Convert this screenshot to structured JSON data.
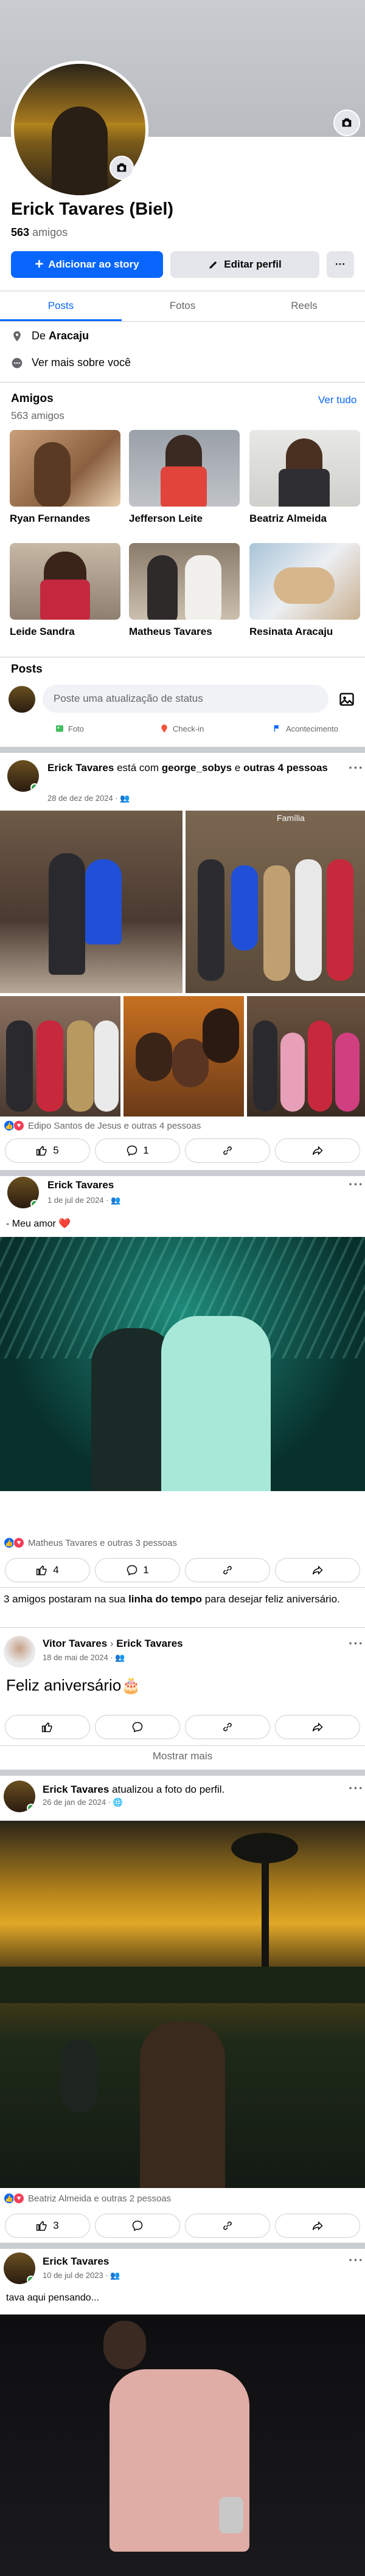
{
  "profile": {
    "name": "Erick Tavares (Biel)",
    "friends_count": "563",
    "friends_suffix": "amigos",
    "add_story": "Adicionar ao story",
    "edit_profile": "Editar perfil",
    "more": "···"
  },
  "tabs": [
    "Posts",
    "Fotos",
    "Reels"
  ],
  "about": {
    "from_prefix": "De",
    "from_city": "Aracaju",
    "see_more": "Ver mais sobre você"
  },
  "friends": {
    "title": "Amigos",
    "count": "563 amigos",
    "see_all": "Ver tudo",
    "list": [
      {
        "name": "Ryan Fernandes"
      },
      {
        "name": "Jefferson Leite"
      },
      {
        "name": "Beatriz Almeida"
      },
      {
        "name": "Leide Sandra"
      },
      {
        "name": "Matheus Tavares"
      },
      {
        "name": "Resinata Aracaju"
      }
    ]
  },
  "posts_section": {
    "title": "Posts",
    "composer_placeholder": "Poste uma atualização de status",
    "actions": [
      "Foto",
      "Check-in",
      "Acontecimento"
    ]
  },
  "post1": {
    "author": "Erick Tavares",
    "mid": "está com",
    "tagged": "george_sobys",
    "tail_and": "e",
    "tail_others": "outras 4 pessoas",
    "date": "28 de dez de 2024 ·",
    "photo_caption": "Família",
    "reactions": "Edipo Santos de Jesus e outras 4 pessoas",
    "likes": "5",
    "comments": "1"
  },
  "post2": {
    "author": "Erick Tavares",
    "date": "1 de jul de 2024 ·",
    "text": "- Meu amor ❤️",
    "reactions": "Matheus Tavares e outras 3 pessoas",
    "likes": "4",
    "comments": "1"
  },
  "birthday_note": {
    "prefix": "3 amigos postaram na sua",
    "link": "linha do tempo",
    "suffix": "para desejar feliz aniversário."
  },
  "post3": {
    "author": "Vitor Tavares",
    "arrow": "›",
    "target": "Erick Tavares",
    "date": "18 de mai de 2024 ·",
    "text": "Feliz aniversário🎂",
    "show_more": "Mostrar mais"
  },
  "post4": {
    "author": "Erick Tavares",
    "action": "atualizou a foto do perfil.",
    "date": "26 de jan de 2024 ·",
    "reactions": "Beatriz Almeida e outras 2 pessoas",
    "likes": "3"
  },
  "post5": {
    "author": "Erick Tavares",
    "date": "10 de jul de 2023 ·",
    "text": "tava aqui pensando..."
  },
  "colors": {
    "accent": "#0866ff",
    "muted": "#65676b",
    "online": "#31a24c",
    "love": "#f33e58"
  },
  "icons": [
    "camera-icon",
    "plus-icon",
    "pencil-icon",
    "location-pin-icon",
    "more-info-icon",
    "image-icon",
    "photo-icon",
    "checkin-icon",
    "event-icon",
    "like-icon",
    "comment-icon",
    "copy-link-icon",
    "share-icon",
    "globe-icon",
    "friends-icon"
  ]
}
